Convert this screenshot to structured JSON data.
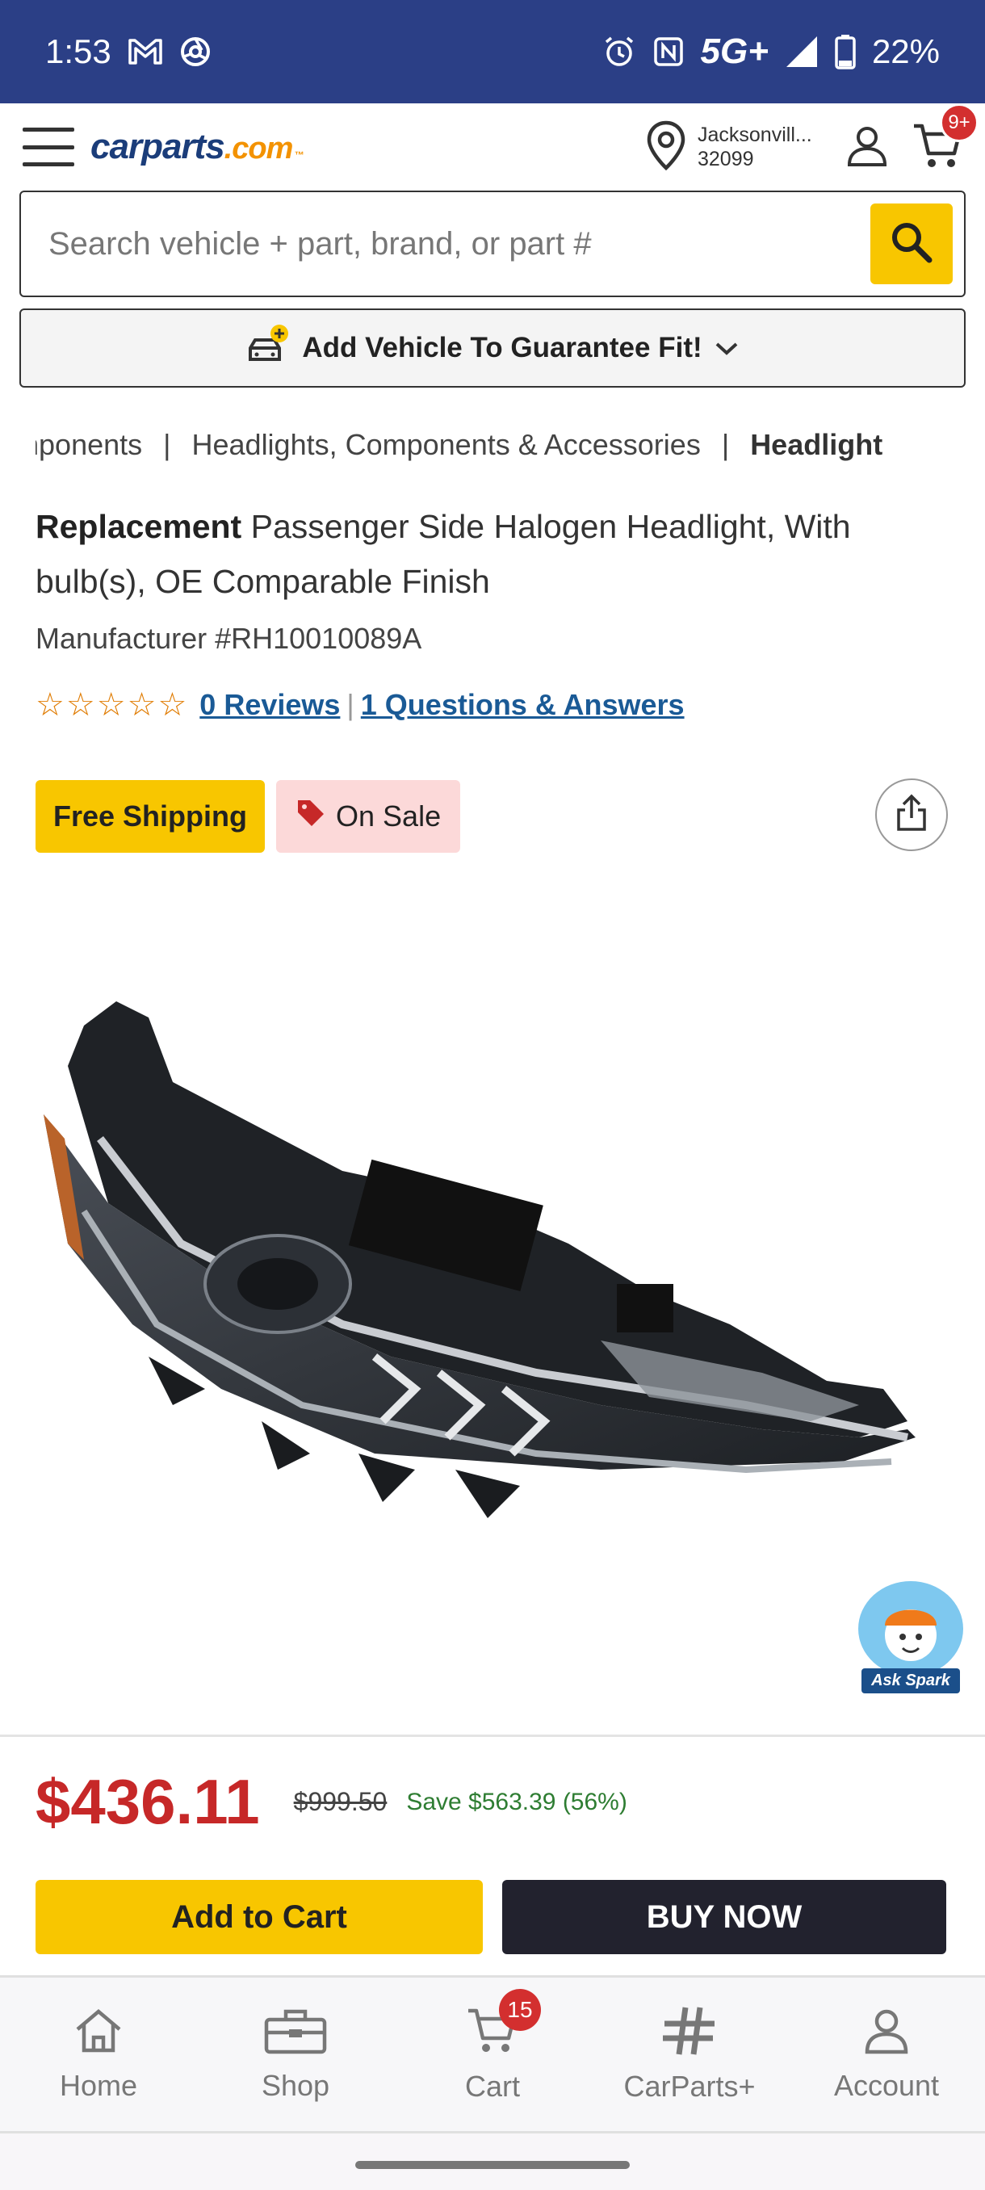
{
  "status_bar": {
    "time": "1:53",
    "network": "5G+",
    "battery": "22%",
    "icons": [
      "gmail-icon",
      "chrome-icon",
      "alarm-icon",
      "nfc-icon",
      "signal-icon",
      "battery-icon"
    ]
  },
  "header": {
    "logo_main": "carparts",
    "logo_dotcom": ".com",
    "logo_tm": "™",
    "location_city": "Jacksonvill...",
    "location_zip": "32099",
    "cart_badge": "9+"
  },
  "search": {
    "placeholder": "Search vehicle + part, brand, or part #"
  },
  "vehicle_bar": {
    "label": "Add Vehicle To Guarantee Fit!"
  },
  "breadcrumb": {
    "items": [
      "nponents",
      "Headlights, Components & Accessories",
      "Headlight"
    ],
    "separator": "|"
  },
  "product": {
    "brand": "Replacement",
    "title": " Passenger Side Halogen Headlight, With bulb(s), OE Comparable Finish",
    "manufacturer": "Manufacturer #RH10010089A",
    "stars": "☆☆☆☆☆",
    "reviews": "0 Reviews",
    "qa": "1 Questions & Answers",
    "badge_shipping": "Free Shipping",
    "badge_sale": "On Sale",
    "ask_spark": "Ask Spark"
  },
  "pricing": {
    "price": "$436.11",
    "old_price": "$999.50",
    "save": "Save $563.39 (56%)"
  },
  "actions": {
    "add_to_cart": "Add to Cart",
    "buy_now": "BUY NOW"
  },
  "bottom_nav": {
    "home": "Home",
    "shop": "Shop",
    "cart": "Cart",
    "cart_badge": "15",
    "carparts_plus": "CarParts+",
    "account": "Account"
  },
  "colors": {
    "status_bar": "#2b3f86",
    "accent_yellow": "#f8c600",
    "price_red": "#c62828",
    "save_green": "#2e7d32",
    "link_blue": "#1a5a96"
  }
}
